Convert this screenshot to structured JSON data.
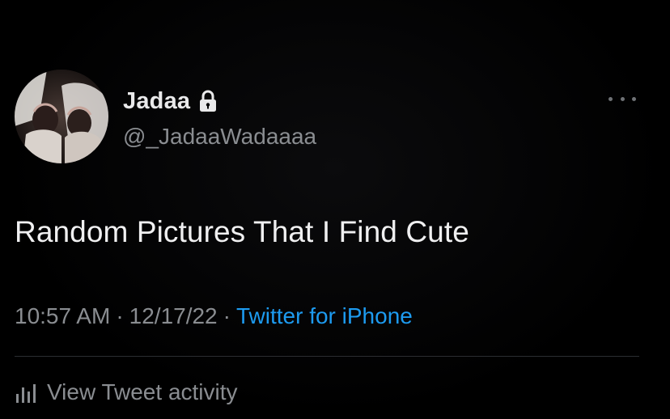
{
  "user": {
    "display_name": "Jadaa",
    "handle": "@_JadaaWadaaaa",
    "verified_icon": "lock-icon",
    "avatar_icon": "avatar-photo"
  },
  "tweet": {
    "text": "Random Pictures That I Find Cute",
    "time": "10:57 AM",
    "date": "12/17/22",
    "separator": "·",
    "source": "Twitter for iPhone"
  },
  "actions": {
    "more_icon": "more-horizontal-icon",
    "activity_label": "View Tweet activity",
    "activity_icon": "bar-chart-icon"
  },
  "colors": {
    "background": "#000000",
    "text_primary": "#f0f0f1",
    "text_secondary": "#8a8d91",
    "link": "#1d9bf0",
    "divider": "#2b2d31"
  }
}
